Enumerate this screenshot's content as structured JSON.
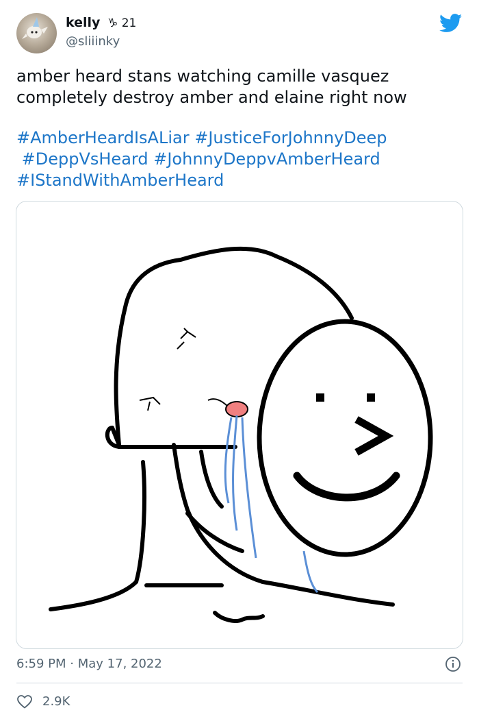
{
  "author": {
    "display_name": "kelly",
    "badge": "♑ 21",
    "handle": "@sliiinky",
    "avatar_icon": "avatar-image"
  },
  "brand": {
    "logo_icon": "twitter-bird-icon",
    "accent": "#1d9bf0"
  },
  "tweet": {
    "text_lines": [
      "amber heard stans watching camille vasquez",
      "completely destroy amber and elaine right now"
    ],
    "hashtags": [
      "#AmberHeardIsALiar",
      "#JusticeForJohnnyDeep",
      "#DeppVsHeard",
      "#JohnnyDeppvAmberHeard",
      "#IStandWithAmberHeard"
    ],
    "hashtag_color": "#1d76c8"
  },
  "media": {
    "description_icon": "wojak-mask-meme-image"
  },
  "meta": {
    "time": "6:59 PM",
    "separator": "·",
    "date": "May 17, 2022",
    "info_icon": "info-icon"
  },
  "engagement": {
    "like_icon": "heart-icon",
    "likes": "2.9K"
  }
}
